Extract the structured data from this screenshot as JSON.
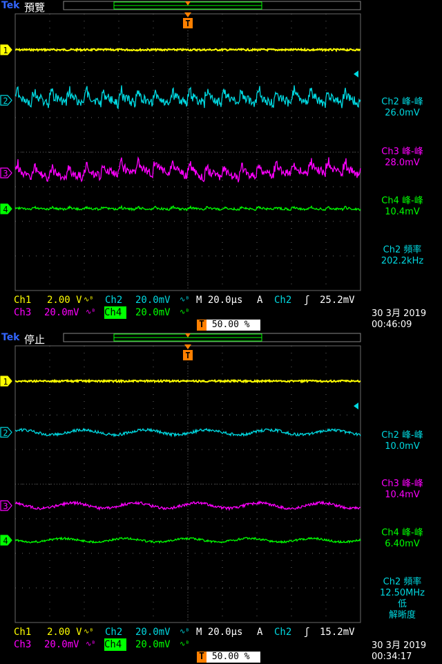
{
  "brand": "Tek",
  "colors": {
    "ch1": "#ffff00",
    "ch2": "#00d8e0",
    "ch3": "#ff00ff",
    "ch4": "#00ff00",
    "trigger": "#ff8000",
    "grid": "#6a6a6a",
    "brand": "#3366ff"
  },
  "icons": {
    "trigger_marker": "T-orange-marker",
    "ground_marker": "arrow-left-marker",
    "trigger_level": "left-arrow-marker",
    "slope": "rising-edge-icon",
    "bw_limit": "bandwidth-limit-icon"
  },
  "screens": [
    {
      "mode": "預覽",
      "measurements": [
        {
          "label": "Ch2 峰-峰",
          "value": "26.0mV",
          "color": "#00d8e0"
        },
        {
          "label": "Ch3 峰-峰",
          "value": "28.0mV",
          "color": "#ff00ff"
        },
        {
          "label": "Ch4 峰-峰",
          "value": "10.4mV",
          "color": "#00ff00"
        },
        {
          "label": "Ch2 頻率",
          "value": "202.2kHz",
          "color": "#00d8e0"
        }
      ],
      "ch1": {
        "label": "Ch1",
        "scale": "2.00 V"
      },
      "ch2": {
        "label": "Ch2",
        "scale": "20.0mV"
      },
      "ch3": {
        "label": "Ch3",
        "scale": "20.0mV"
      },
      "ch4": {
        "label": "Ch4",
        "scale": "20.0mV"
      },
      "timebase": "M 20.0µs",
      "acq": "A",
      "trig_src": "Ch2",
      "trig_level": "25.2mV",
      "trig_pos": "50.00 %",
      "date": "30 3月 2019",
      "time": "00:46:09",
      "markers": [
        "1",
        "2",
        "3",
        "4"
      ]
    },
    {
      "mode": "停止",
      "measurements": [
        {
          "label": "Ch2 峰-峰",
          "value": "10.0mV",
          "color": "#00d8e0"
        },
        {
          "label": "Ch3 峰-峰",
          "value": "10.4mV",
          "color": "#ff00ff"
        },
        {
          "label": "Ch4 峰-峰",
          "value": "6.40mV",
          "color": "#00ff00"
        },
        {
          "label": "Ch2 頻率",
          "value": "12.50MHz",
          "extra": "低",
          "extra2": "解晰度",
          "color": "#00d8e0"
        }
      ],
      "ch1": {
        "label": "Ch1",
        "scale": "2.00 V"
      },
      "ch2": {
        "label": "Ch2",
        "scale": "20.0mV"
      },
      "ch3": {
        "label": "Ch3",
        "scale": "20.0mV"
      },
      "ch4": {
        "label": "Ch4",
        "scale": "20.0mV"
      },
      "timebase": "M 20.0µs",
      "acq": "A",
      "trig_src": "Ch2",
      "trig_level": "15.2mV",
      "trig_pos": "50.00 %",
      "date": "30 3月 2019",
      "time": "00:34:17",
      "markers": [
        "1",
        "2",
        "3",
        "4"
      ]
    }
  ]
}
